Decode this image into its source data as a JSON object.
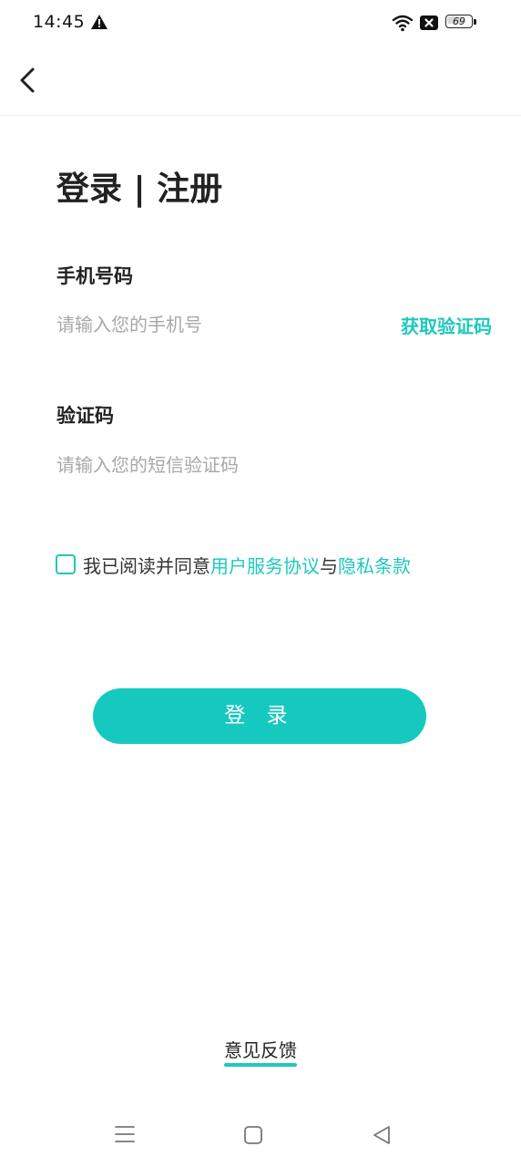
{
  "status_bar": {
    "time": "14:45",
    "battery_level": "69",
    "icons": [
      "alert-triangle-icon",
      "wifi-icon",
      "no-sim-icon",
      "battery-icon"
    ]
  },
  "nav": {
    "back_icon": "chevron-left-icon"
  },
  "page_title": "登录 | 注册",
  "phone": {
    "label": "手机号码",
    "placeholder": "请输入您的手机号",
    "value": "",
    "get_code_label": "获取验证码"
  },
  "code": {
    "label": "验证码",
    "placeholder": "请输入您的短信验证码",
    "value": ""
  },
  "agreement": {
    "checked": false,
    "prefix": "我已阅读并同意",
    "user_agreement": "用户服务协议",
    "conjunction": "与",
    "privacy": "隐私条款"
  },
  "login_label": "登 录",
  "feedback_label": "意见反馈",
  "system_nav": [
    "menu-icon",
    "home-icon",
    "back-triangle-icon"
  ],
  "colors": {
    "accent": "#1ec8bd",
    "button": "#16c9bf",
    "text": "#222222",
    "placeholder": "#a8a8a8"
  }
}
